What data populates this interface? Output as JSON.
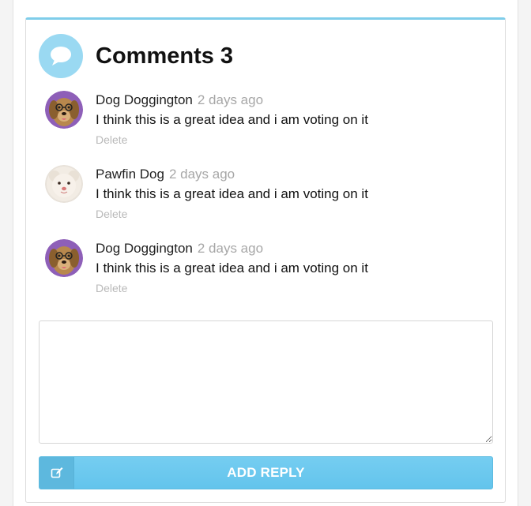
{
  "comments_panel": {
    "title": "Comments 3",
    "header_icon": "speech-bubble-icon",
    "accent_color": "#7fcdea",
    "button_color": "#6ac8ee"
  },
  "comments": [
    {
      "author": "Dog Doggington",
      "time": "2 days ago",
      "text": "I think this is a great idea and i am voting on it",
      "delete_label": "Delete",
      "avatar": "golden-retriever-avatar"
    },
    {
      "author": "Pawfin Dog",
      "time": "2 days ago",
      "text": "I think this is a great idea and i am voting on it",
      "delete_label": "Delete",
      "avatar": "white-puppy-avatar"
    },
    {
      "author": "Dog Doggington",
      "time": "2 days ago",
      "text": "I think this is a great idea and i am voting on it",
      "delete_label": "Delete",
      "avatar": "golden-retriever-avatar"
    }
  ],
  "reply": {
    "value": "",
    "button_label": "ADD REPLY",
    "button_icon": "edit-icon"
  }
}
